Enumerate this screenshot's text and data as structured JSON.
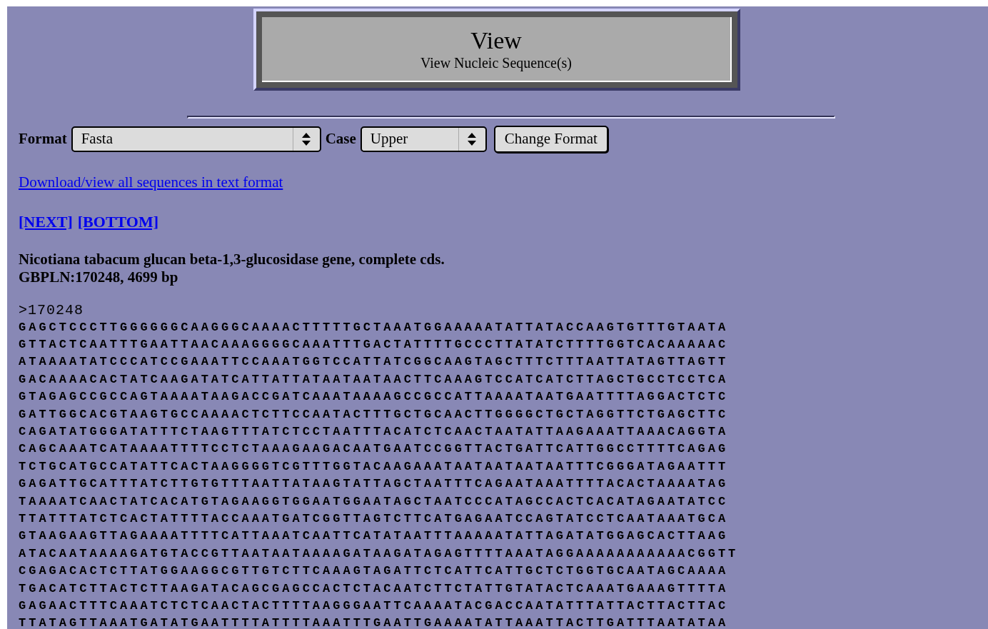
{
  "header": {
    "title": "View",
    "subtitle": "View Nucleic Sequence(s)"
  },
  "form": {
    "fields": [
      {
        "label": "Format",
        "value": "Fasta"
      },
      {
        "label": "Case",
        "value": "Upper"
      }
    ],
    "button": "Change Format"
  },
  "download_link": "Download/view all sequences in text format",
  "nav_links": [
    "[NEXT]",
    "[BOTTOM]"
  ],
  "record": {
    "description": "Nicotiana tabacum glucan beta-1,3-glucosidase gene, complete cds.",
    "accession": "GBPLN:170248, 4699 bp"
  },
  "sequence": {
    "header": ">170248",
    "lines": [
      "GAGCTCCCTTGGGGGGCAAGGGCAAAACTTTTTGCTAAATGGAAAAATATTATACCAAGTGTTTGTAATA",
      "GTTACTCAATTTGAATTAACAAAGGGGCAAATTTGACTATTTTGCCCTTATATCTTTTGGTCACAAAAAC",
      "ATAAAATATCCCATCCGAAATTCCAAATGGTCCATTATCGGCAAGTAGCTTTCTTTAATTATAGTTAGTT",
      "GACAAAACACTATCAAGATATCATTATTATAATAATAACTTCAAAGTCCATCATCTTAGCTGCCTCCTCA",
      "GTAGAGCCGCCAGTAAAATAAGACCGATCAAATAAAAGCCGCCATTAAAATAATGAATTTTAGGACTCTC",
      "GATTGGCACGTAAGTGCCAAAACTCTTCCAATACTTTGCTGCAACTTGGGGCTGCTAGGTTCTGAGCTTC",
      "CAGATATGGGATATTTCTAAGTTTATCTCCTAATTTACATCTCAACTAATATTAAGAAATTAAACAGGTA",
      "CAGCAAATCATAAAATTTTCCTCTAAAGAAGACAATGAATCCGGTTACTGATTCATTGGCCTTTTCAGAG",
      "TCTGCATGCCATATTCACTAAGGGGTCGTTTGGTACAAGAAATAATAATAATAATTTCGGGATAGAATTT",
      "GAGATTGCATTTATCTTGTGTTTAATTATAAGTATTAGCTAATTTCAGAATAAATTTTACACTAAAATAG",
      "TAAAATCAACTATCACATGTAGAAGGTGGAATGGAATAGCTAATCCCATAGCCACTCACATAGAATATCC",
      "TTATTTATCTCACTATTTTACCAAATGATCGGTTAGTCTTCATGAGAATCCAGTATCCTCAATAAATGCA",
      "GTAAGAAGTTAGAAAATTTTCATTAAATCAATTCATATAATTTAAAAATATTAGATATGGAGCACTTAAG",
      "ATACAATAAAAGATGTACCGTTAATAATAAAAGATAAGATAGAGTTTTAAATAGGAAAAAAAAAAACGGTT",
      "CGAGACACTCTTATGGAAGGCGTTGTCTTCAAAGTAGATTCTCATTCATTGCTCTGGTGCAATAGCAAAA",
      "TGACATCTTACTCTTAAGATACAGCGAGCCACTCTACAATCTTCTATTGTATACTCAAATGAAAGTTTTA",
      "GAGAACTTTCAAATCTCTCAACTACTTTTAAGGGAATTCAAAATACGACCAATATTTATTACTTACTTAC",
      "TTATAGTTAAATGATATGAATTTTATTTTAAATTTGAATTGAAAATATTAAATTACTTGATTTAATATAA"
    ]
  }
}
